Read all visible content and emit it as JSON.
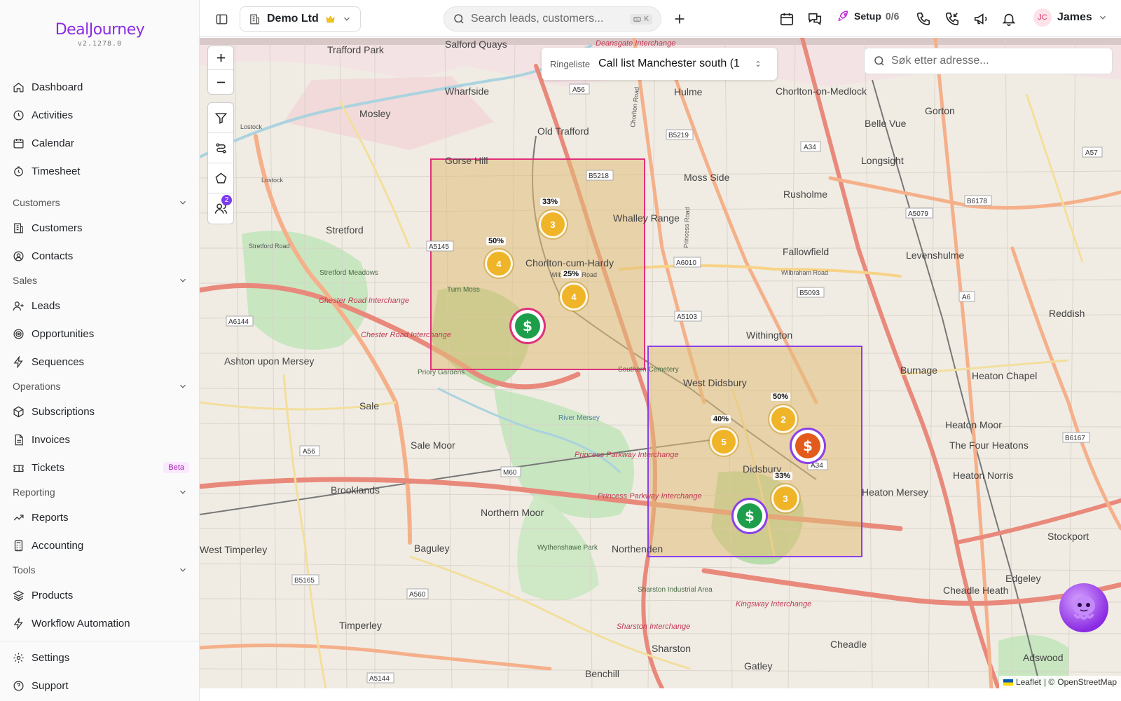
{
  "brand": {
    "logo_text": "DealJourney",
    "version": "v2.1278.0"
  },
  "sidebar": {
    "items_top": [
      {
        "label": "Dashboard",
        "icon": "home-icon"
      },
      {
        "label": "Activities",
        "icon": "clock-icon"
      },
      {
        "label": "Calendar",
        "icon": "calendar-icon"
      },
      {
        "label": "Timesheet",
        "icon": "timer-icon"
      }
    ],
    "sections": {
      "customers": {
        "label": "Customers",
        "items": [
          "Customers",
          "Contacts"
        ]
      },
      "sales": {
        "label": "Sales",
        "items": [
          "Leads",
          "Opportunities",
          "Sequences"
        ]
      },
      "operations": {
        "label": "Operations",
        "items": [
          "Subscriptions",
          "Invoices",
          "Tickets"
        ],
        "tickets_badge": "Beta"
      },
      "reporting": {
        "label": "Reporting",
        "items": [
          "Reports",
          "Accounting"
        ]
      },
      "tools": {
        "label": "Tools",
        "items": [
          "Products",
          "Workflow Automation"
        ]
      }
    },
    "bottom": [
      "Settings",
      "Support"
    ]
  },
  "topbar": {
    "org_name": "Demo Ltd",
    "search_placeholder": "Search leads, customers...",
    "search_shortcut": "K",
    "setup_label": "Setup",
    "setup_count": "0/6",
    "user_initials": "JC",
    "user_name": "James"
  },
  "map": {
    "list_label": "Ringeliste",
    "list_value": "Call list Manchester south (1",
    "address_placeholder": "Søk etter adresse...",
    "controls_badge": "2",
    "attribution_leaflet": "Leaflet",
    "attribution_sep": "| ©",
    "attribution_osm": "OpenStreetMap",
    "clusters": [
      {
        "count": "3",
        "pct": "33%"
      },
      {
        "count": "4",
        "pct": "50%"
      },
      {
        "count": "4",
        "pct": "25%"
      },
      {
        "count": "2",
        "pct": "50%"
      },
      {
        "count": "5",
        "pct": "40%"
      },
      {
        "count": "3",
        "pct": "33%"
      }
    ],
    "deal_symbol": "$",
    "labels": {
      "trafford_park": "Trafford Park",
      "salford_quays": "Salford Quays",
      "wharfside": "Wharfside",
      "mosley": "Mosley",
      "old_trafford": "Old Trafford",
      "hulme": "Hulme",
      "chorlton_medlock": "Chorlton-on-Medlock",
      "gorton": "Gorton",
      "belle_vue": "Belle Vue",
      "longsight": "Longsight",
      "moss_side": "Moss Side",
      "rusholme": "Rusholme",
      "gorse_hill": "Gorse Hill",
      "whalley_range": "Whalley Range",
      "stretford": "Stretford",
      "chorlton": "Chorlton-cum-Hardy",
      "fallowfield": "Fallowfield",
      "levenshulme": "Levenshulme",
      "withington": "Withington",
      "reddish": "Reddish",
      "ashton": "Ashton upon Mersey",
      "west_didsbury": "West Didsbury",
      "burnage": "Burnage",
      "heaton_chapel": "Heaton Chapel",
      "sale": "Sale",
      "sale_moor": "Sale Moor",
      "didsbury": "Didsbury",
      "heaton_moor": "Heaton Moor",
      "four_heatons": "The Four Heatons",
      "heaton_norris": "Heaton Norris",
      "heaton_mersey": "Heaton Mersey",
      "brooklands": "Brooklands",
      "northern_moor": "Northern Moor",
      "northenden": "Northenden",
      "stockport": "Stockport",
      "baguley": "Baguley",
      "west_timperley": "West Timperley",
      "edgeley": "Edgeley",
      "cheadle_heath": "Cheadle Heath",
      "timperley": "Timperley",
      "cheadle": "Cheadle",
      "sharston": "Sharston",
      "adswood": "Adswood",
      "benchill": "Benchill",
      "gatley": "Gatley",
      "princess_parkway": "Princess Parkway Interchange",
      "chester_road": "Chester Road Interchange",
      "kingsway": "Kingsway Interchange",
      "sharston_interchange": "Sharston Interchange",
      "southern_cemetery": "Southern Cemetery",
      "turn_moss": "Turn Moss",
      "priory_gardens": "Priory Gardens",
      "wythenshawe_park": "Wythenshawe Park",
      "sharston_industrial": "Sharston Industrial Area",
      "stretford_meadows": "Stretford Meadows",
      "river_mersey": "River Mersey",
      "deansgate": "Deansgate Interchange",
      "a56": "A56",
      "a5145": "A5145",
      "a6010": "A6010",
      "a5103": "A5103",
      "a34": "A34",
      "a6": "A6",
      "a57": "A57",
      "a5079": "A5079",
      "b6178": "B6178",
      "b5218": "B5218",
      "b5219": "B5219",
      "b5093": "B5093",
      "b6167": "B6167",
      "a6144": "A6144",
      "m60": "M60",
      "a560": "A560",
      "b5165": "B5165",
      "a5144": "A5144",
      "wilbraham_road": "Wilbraham Road",
      "stretford_road": "Stretford Road",
      "lostock": "Lostock",
      "chorlton_road": "Chorlton Road",
      "princess_road": "Princess Road"
    }
  },
  "colors": {
    "brand": "#8b2be2",
    "zone_pink": "#e0307a",
    "zone_purple": "#8b3fe8",
    "cluster": "#f0b429",
    "deal_green": "#1e9e4a",
    "deal_orange": "#e25a1c"
  }
}
